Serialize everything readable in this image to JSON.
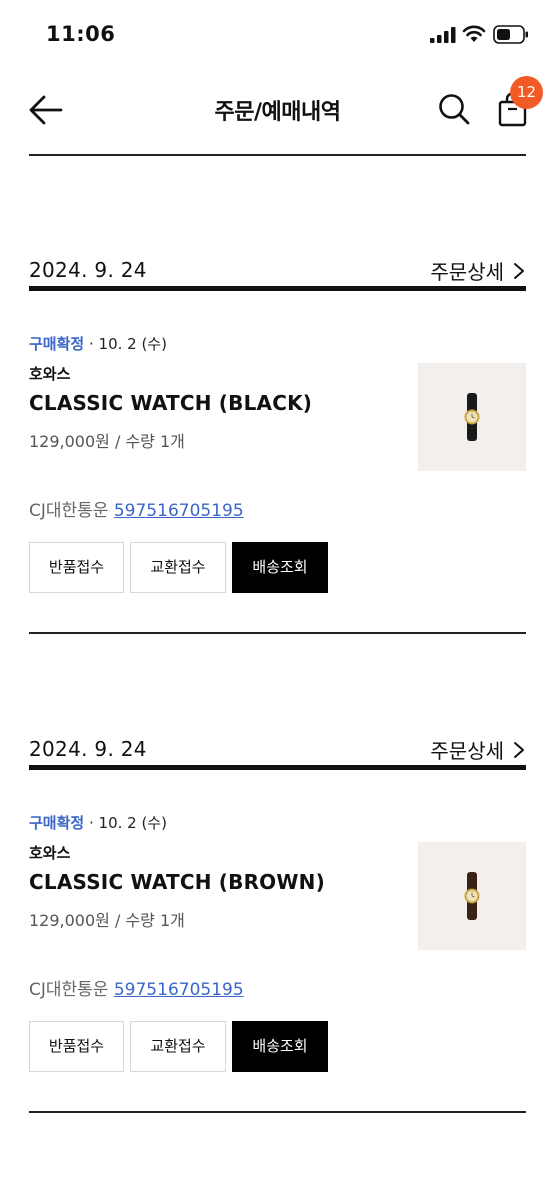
{
  "status_bar": {
    "time": "11:06"
  },
  "header": {
    "title": "주문/예매내역",
    "cart_count": "12"
  },
  "orders": [
    {
      "date": "2024. 9. 24",
      "detail_label": "주문상세",
      "status": "구매확정",
      "status_date": "· 10. 2 (수)",
      "brand": "호와스",
      "product": "CLASSIC WATCH (BLACK)",
      "price_qty": "129,000원 / 수량 1개",
      "courier": "CJ대한통운",
      "tracking": "597516705195",
      "buttons": {
        "return": "반품접수",
        "exchange": "교환접수",
        "track": "배송조회"
      },
      "strap_color": "#1a1a1a"
    },
    {
      "date": "2024. 9. 24",
      "detail_label": "주문상세",
      "status": "구매확정",
      "status_date": "· 10. 2 (수)",
      "brand": "호와스",
      "product": "CLASSIC WATCH (BROWN)",
      "price_qty": "129,000원 / 수량 1개",
      "courier": "CJ대한통운",
      "tracking": "597516705195",
      "buttons": {
        "return": "반품접수",
        "exchange": "교환접수",
        "track": "배송조회"
      },
      "strap_color": "#3b2216"
    }
  ],
  "colors": {
    "accent_blue": "#3a67c7",
    "badge_orange": "#f15a22",
    "primary_button": "#000000"
  },
  "icons": [
    "signal-icon",
    "wifi-icon",
    "battery-icon",
    "back-arrow-icon",
    "search-icon",
    "shopping-bag-icon",
    "chevron-right-icon"
  ]
}
